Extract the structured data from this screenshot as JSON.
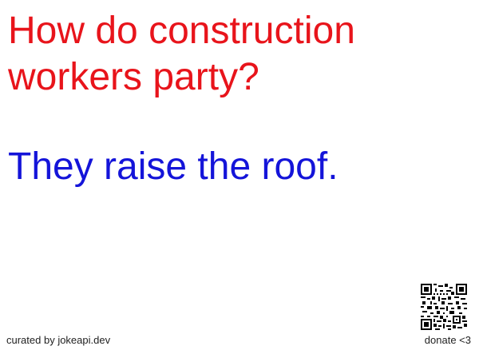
{
  "joke": {
    "setup": "How do construction workers party?",
    "delivery": "They raise the roof.",
    "setup_color": "#e8141b",
    "delivery_color": "#1414d9"
  },
  "footer": {
    "credit": "curated by jokeapi.dev",
    "donate": "donate <3"
  },
  "qr_icon": "qr-code-icon"
}
